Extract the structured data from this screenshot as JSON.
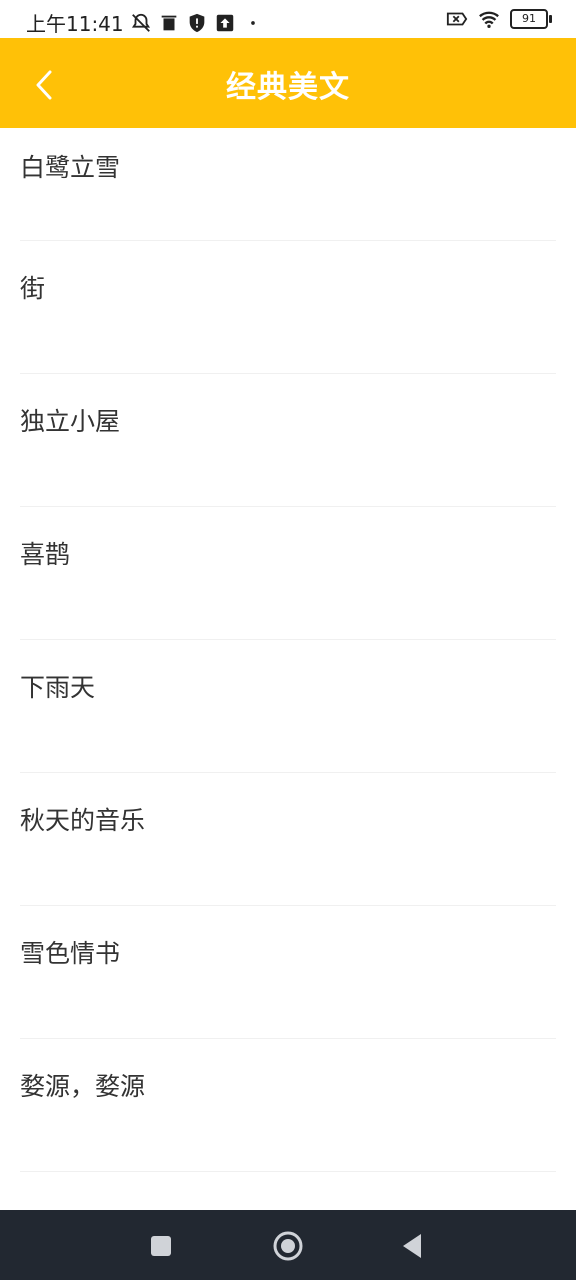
{
  "status_bar": {
    "time": "上午11:41",
    "battery": "91"
  },
  "header": {
    "title": "经典美文"
  },
  "list": {
    "items": [
      {
        "label": "白鹭立雪"
      },
      {
        "label": "街"
      },
      {
        "label": "独立小屋"
      },
      {
        "label": "喜鹊"
      },
      {
        "label": "下雨天"
      },
      {
        "label": "秋天的音乐"
      },
      {
        "label": "雪色情书"
      },
      {
        "label": "婺源，婺源"
      }
    ]
  },
  "colors": {
    "header_bg": "#ffc107",
    "nav_bg": "#222831",
    "text": "#333333"
  }
}
